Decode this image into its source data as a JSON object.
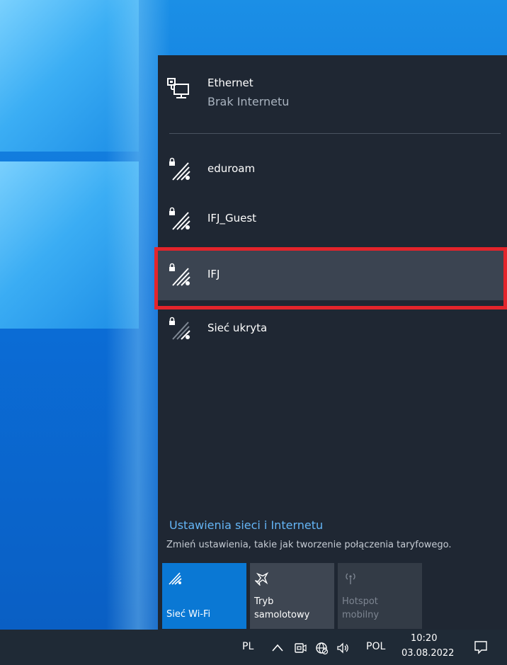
{
  "ethernet": {
    "name": "Ethernet",
    "status": "Brak Internetu",
    "icon": "ethernet-icon"
  },
  "networks": [
    {
      "name": "eduroam",
      "icon": "wifi-secured-icon",
      "selected": false
    },
    {
      "name": "IFJ_Guest",
      "icon": "wifi-secured-icon",
      "selected": false
    },
    {
      "name": "IFJ",
      "icon": "wifi-secured-icon",
      "selected": true
    },
    {
      "name": "Sieć ukryta",
      "icon": "wifi-secured-weak-icon",
      "selected": false
    }
  ],
  "settings": {
    "link": "Ustawienia sieci i Internetu",
    "description": "Zmień ustawienia, takie jak tworzenie połączenia taryfowego."
  },
  "quick_actions": {
    "wifi": {
      "line1": "Sieć Wi-Fi",
      "icon": "wifi-icon",
      "active": true
    },
    "airplane": {
      "line1": "Tryb",
      "line2": "samolotowy",
      "icon": "airplane-icon",
      "active": false
    },
    "hotspot": {
      "line1": "Hotspot",
      "line2": "mobilny",
      "icon": "hotspot-icon",
      "disabled": true
    }
  },
  "taskbar": {
    "lang_short": "PL",
    "lang": "POL",
    "time": "10:20",
    "date": "03.08.2022"
  },
  "colors": {
    "flyout_bg": "#1f2733",
    "selected_bg": "#3b4451",
    "accent": "#0a78d4",
    "link": "#64b5f6",
    "highlight": "#e3242b"
  }
}
